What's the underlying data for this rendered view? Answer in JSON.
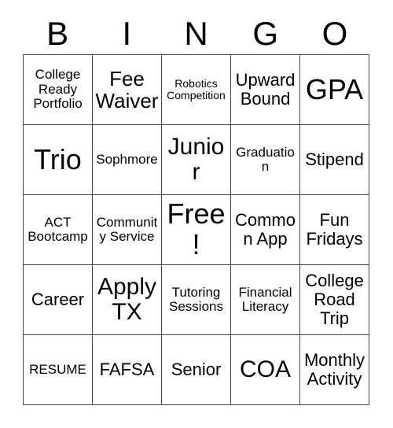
{
  "card": {
    "title": "BINGO",
    "header_letters": [
      "B",
      "I",
      "N",
      "G",
      "O"
    ],
    "columns": 5,
    "rows": 5,
    "border_color": "#444444",
    "text_color": "#000000",
    "background_color": "#ffffff",
    "grid": [
      [
        {
          "label": "College Ready Portfolio",
          "size": "sm",
          "free": false
        },
        {
          "label": "Fee Waiver",
          "size": "lg",
          "free": false
        },
        {
          "label": "Robotics Competition",
          "size": "xs",
          "free": false
        },
        {
          "label": "Upward Bound",
          "size": "md",
          "free": false
        },
        {
          "label": "GPA",
          "size": "xxl",
          "free": false
        }
      ],
      [
        {
          "label": "Trio",
          "size": "xxl",
          "free": false
        },
        {
          "label": "Sophmore",
          "size": "sm",
          "free": false
        },
        {
          "label": "Junior",
          "size": "xl",
          "free": false
        },
        {
          "label": "Graduation",
          "size": "sm",
          "free": false
        },
        {
          "label": "Stipend",
          "size": "md",
          "free": false
        }
      ],
      [
        {
          "label": "ACT Bootcamp",
          "size": "sm",
          "free": false
        },
        {
          "label": "Community Service",
          "size": "sm",
          "free": false
        },
        {
          "label": "Free!",
          "size": "xxl",
          "free": true
        },
        {
          "label": "Common App",
          "size": "md",
          "free": false
        },
        {
          "label": "Fun Fridays",
          "size": "md",
          "free": false
        }
      ],
      [
        {
          "label": "Career",
          "size": "md",
          "free": false
        },
        {
          "label": "Apply TX",
          "size": "xl",
          "free": false
        },
        {
          "label": "Tutoring Sessions",
          "size": "sm",
          "free": false
        },
        {
          "label": "Financial Literacy",
          "size": "sm",
          "free": false
        },
        {
          "label": "College Road Trip",
          "size": "md",
          "free": false
        }
      ],
      [
        {
          "label": "RESUME",
          "size": "sm",
          "free": false
        },
        {
          "label": "FAFSA",
          "size": "md",
          "free": false
        },
        {
          "label": "Senior",
          "size": "md",
          "free": false
        },
        {
          "label": "COA",
          "size": "xl",
          "free": false
        },
        {
          "label": "Monthly Activity",
          "size": "md",
          "free": false
        }
      ]
    ]
  }
}
